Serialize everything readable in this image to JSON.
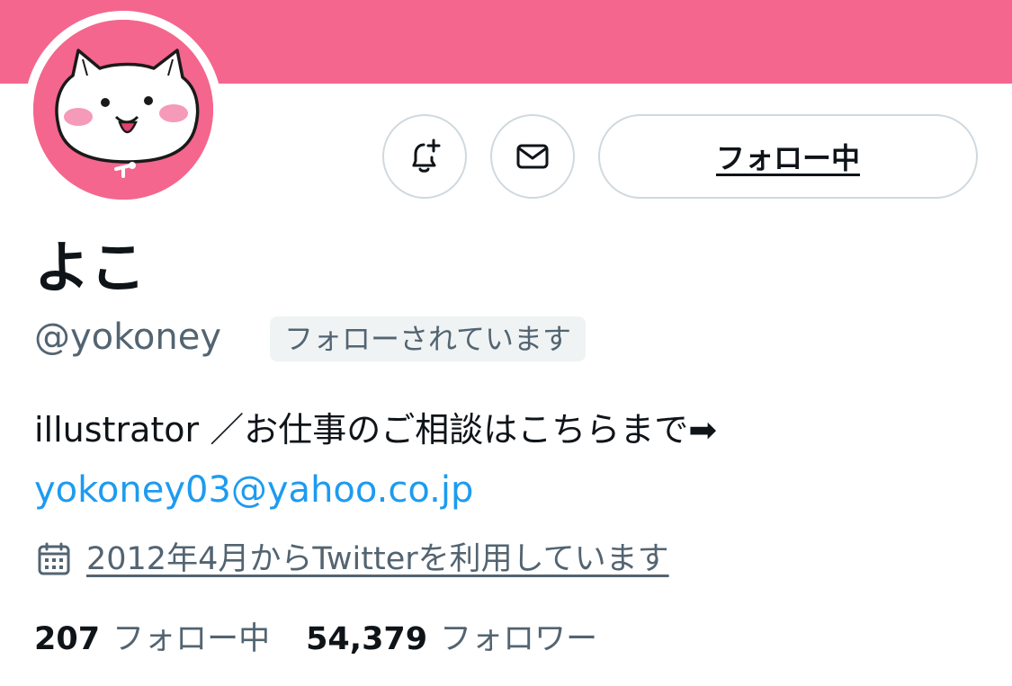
{
  "profile": {
    "display_name": "よこ",
    "handle": "@yokoney",
    "follows_you_badge": "フォローされています",
    "bio_text": "illustrator ／お仕事のご相談はこちらまで➡",
    "bio_link": "yokoney03@yahoo.co.jp",
    "joined": "2012年4月からTwitterを利用しています"
  },
  "actions": {
    "notify_icon": "bell-plus-icon",
    "message_icon": "envelope-icon",
    "follow_button_label": "フォロー中"
  },
  "stats": {
    "following_count": "207",
    "following_label": "フォロー中",
    "followers_count": "54,379",
    "followers_label": "フォロワー"
  },
  "colors": {
    "banner": "#f4668d",
    "link": "#1d9bf0",
    "secondary_text": "#536471",
    "border": "#cfd9de"
  }
}
